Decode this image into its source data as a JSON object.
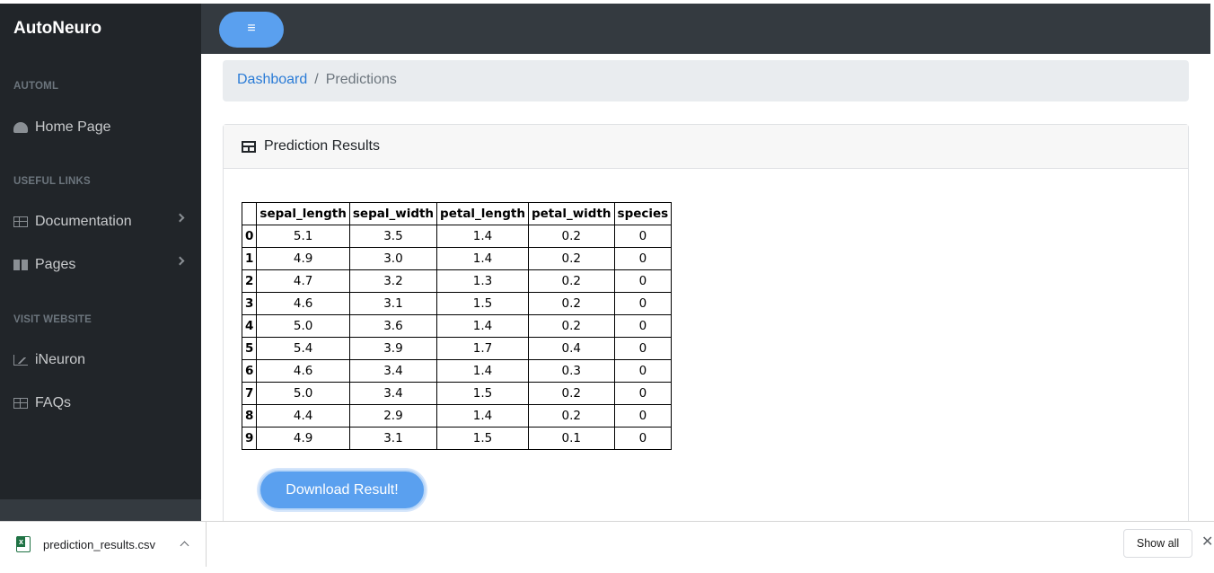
{
  "navbar": {
    "brand": "AutoNeuro",
    "toggle_icon": "≡"
  },
  "sidebar": {
    "sections": [
      {
        "heading": "AUTOML",
        "items": [
          {
            "label": "Home Page",
            "icon": "gauge-icon"
          }
        ]
      },
      {
        "heading": "USEFUL LINKS",
        "items": [
          {
            "label": "Documentation",
            "icon": "columns-icon"
          },
          {
            "label": "Pages",
            "icon": "book-icon"
          }
        ]
      },
      {
        "heading": "VISIT WEBSITE",
        "items": [
          {
            "label": "iNeuron",
            "icon": "chart-icon"
          },
          {
            "label": "FAQs",
            "icon": "table-icon"
          }
        ]
      }
    ]
  },
  "breadcrumb": {
    "link": "Dashboard",
    "separator": "/",
    "current": "Predictions"
  },
  "card": {
    "title": "Prediction Results",
    "table": {
      "columns": [
        "sepal_length",
        "sepal_width",
        "petal_length",
        "petal_width",
        "species"
      ],
      "rows": [
        {
          "index": "0",
          "cells": [
            "5.1",
            "3.5",
            "1.4",
            "0.2",
            "0"
          ]
        },
        {
          "index": "1",
          "cells": [
            "4.9",
            "3.0",
            "1.4",
            "0.2",
            "0"
          ]
        },
        {
          "index": "2",
          "cells": [
            "4.7",
            "3.2",
            "1.3",
            "0.2",
            "0"
          ]
        },
        {
          "index": "3",
          "cells": [
            "4.6",
            "3.1",
            "1.5",
            "0.2",
            "0"
          ]
        },
        {
          "index": "4",
          "cells": [
            "5.0",
            "3.6",
            "1.4",
            "0.2",
            "0"
          ]
        },
        {
          "index": "5",
          "cells": [
            "5.4",
            "3.9",
            "1.7",
            "0.4",
            "0"
          ]
        },
        {
          "index": "6",
          "cells": [
            "4.6",
            "3.4",
            "1.4",
            "0.3",
            "0"
          ]
        },
        {
          "index": "7",
          "cells": [
            "5.0",
            "3.4",
            "1.5",
            "0.2",
            "0"
          ]
        },
        {
          "index": "8",
          "cells": [
            "4.4",
            "2.9",
            "1.4",
            "0.2",
            "0"
          ]
        },
        {
          "index": "9",
          "cells": [
            "4.9",
            "3.1",
            "1.5",
            "0.1",
            "0"
          ]
        }
      ]
    },
    "download_label": "Download Result!"
  },
  "download_bar": {
    "filename": "prediction_results.csv",
    "show_all": "Show all",
    "close": "✕"
  }
}
